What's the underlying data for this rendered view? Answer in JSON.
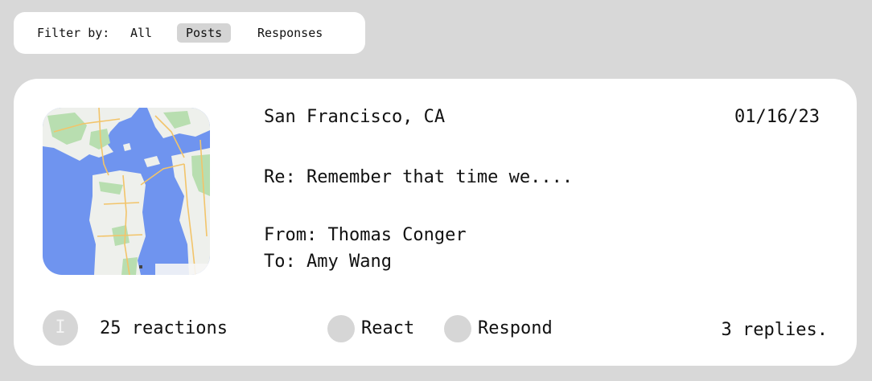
{
  "filter": {
    "label": "Filter by:",
    "options": [
      "All",
      "Posts",
      "Responses"
    ],
    "selected": "Posts"
  },
  "post": {
    "location": "San Francisco, CA",
    "date": "01/16/23",
    "subject": "Re: Remember that time we....",
    "from": "From: Thomas Conger",
    "to": "To: Amy Wang",
    "map_icon": "map-thumbnail",
    "avatar_initial": "I",
    "reactions": "25 reactions",
    "react_label": "React",
    "respond_label": "Respond",
    "replies": "3 replies."
  },
  "colors": {
    "background": "#d8d8d8",
    "card": "#ffffff",
    "selected_filter": "#d4d4d4",
    "placeholder_circle": "#d6d6d6",
    "map_water": "#6f94ef",
    "map_land": "#eef0ec",
    "map_park": "#b8deb0",
    "map_road": "#f2c46a"
  }
}
